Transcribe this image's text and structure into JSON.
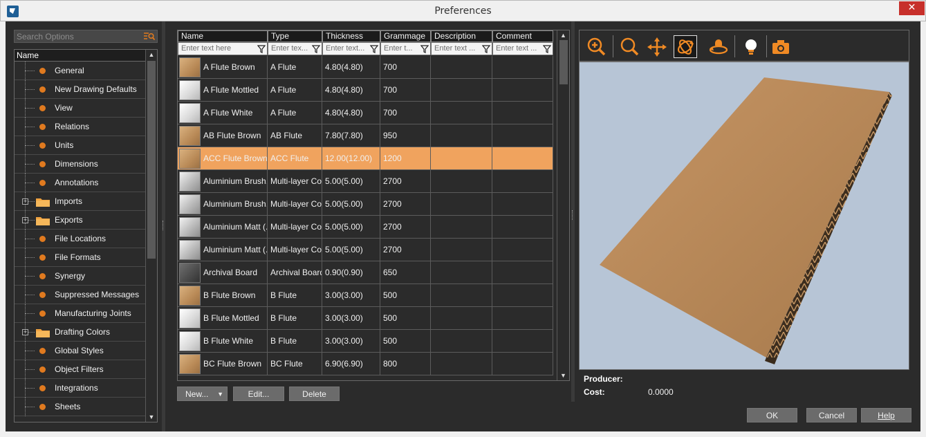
{
  "window": {
    "title": "Preferences",
    "close_glyph": "✕"
  },
  "search": {
    "placeholder": "Search Options"
  },
  "tree": {
    "header": "Name",
    "items": [
      {
        "label": "General",
        "kind": "leaf"
      },
      {
        "label": "New Drawing Defaults",
        "kind": "leaf"
      },
      {
        "label": "View",
        "kind": "leaf"
      },
      {
        "label": "Relations",
        "kind": "leaf"
      },
      {
        "label": "Units",
        "kind": "leaf"
      },
      {
        "label": "Dimensions",
        "kind": "leaf"
      },
      {
        "label": "Annotations",
        "kind": "leaf"
      },
      {
        "label": "Imports",
        "kind": "folder"
      },
      {
        "label": "Exports",
        "kind": "folder"
      },
      {
        "label": "File Locations",
        "kind": "leaf"
      },
      {
        "label": "File Formats",
        "kind": "leaf"
      },
      {
        "label": "Synergy",
        "kind": "leaf"
      },
      {
        "label": "Suppressed Messages",
        "kind": "leaf"
      },
      {
        "label": "Manufacturing Joints",
        "kind": "leaf"
      },
      {
        "label": "Drafting Colors",
        "kind": "folder"
      },
      {
        "label": "Global Styles",
        "kind": "leaf"
      },
      {
        "label": "Object Filters",
        "kind": "leaf"
      },
      {
        "label": "Integrations",
        "kind": "leaf"
      },
      {
        "label": "Sheets",
        "kind": "leaf"
      }
    ]
  },
  "grid": {
    "columns": [
      {
        "label": "Name",
        "filter": "Enter text here"
      },
      {
        "label": "Type",
        "filter": "Enter tex..."
      },
      {
        "label": "Thickness",
        "filter": "Enter text..."
      },
      {
        "label": "Grammage",
        "filter": "Enter t..."
      },
      {
        "label": "Description",
        "filter": "Enter text ..."
      },
      {
        "label": "Comment",
        "filter": "Enter text ..."
      }
    ],
    "rows": [
      {
        "name": "A Flute Brown",
        "type": "A Flute",
        "thickness": "4.80(4.80)",
        "grammage": "700",
        "swatch": "brown"
      },
      {
        "name": "A Flute Mottled",
        "type": "A Flute",
        "thickness": "4.80(4.80)",
        "grammage": "700",
        "swatch": "white"
      },
      {
        "name": "A Flute White",
        "type": "A Flute",
        "thickness": "4.80(4.80)",
        "grammage": "700",
        "swatch": "white"
      },
      {
        "name": "AB Flute Brown",
        "type": "AB Flute",
        "thickness": "7.80(7.80)",
        "grammage": "950",
        "swatch": "brown"
      },
      {
        "name": "ACC Flute Brown",
        "type": "ACC Flute",
        "thickness": "12.00(12.00)",
        "grammage": "1200",
        "swatch": "brown",
        "selected": true
      },
      {
        "name": "Aluminium Brush...",
        "type": "Multi-layer Co...",
        "thickness": "5.00(5.00)",
        "grammage": "2700",
        "swatch": "metal"
      },
      {
        "name": "Aluminium Brush...",
        "type": "Multi-layer Co...",
        "thickness": "5.00(5.00)",
        "grammage": "2700",
        "swatch": "metal"
      },
      {
        "name": "Aluminium Matt (...",
        "type": "Multi-layer Co...",
        "thickness": "5.00(5.00)",
        "grammage": "2700",
        "swatch": "metal"
      },
      {
        "name": "Aluminium Matt (...",
        "type": "Multi-layer Co...",
        "thickness": "5.00(5.00)",
        "grammage": "2700",
        "swatch": "metal"
      },
      {
        "name": "Archival Board",
        "type": "Archival Board",
        "thickness": "0.90(0.90)",
        "grammage": "650",
        "swatch": "dark"
      },
      {
        "name": "B Flute Brown",
        "type": "B Flute",
        "thickness": "3.00(3.00)",
        "grammage": "500",
        "swatch": "brown"
      },
      {
        "name": "B Flute Mottled",
        "type": "B Flute",
        "thickness": "3.00(3.00)",
        "grammage": "500",
        "swatch": "white"
      },
      {
        "name": "B Flute White",
        "type": "B Flute",
        "thickness": "3.00(3.00)",
        "grammage": "500",
        "swatch": "white"
      },
      {
        "name": "BC Flute Brown",
        "type": "BC Flute",
        "thickness": "6.90(6.90)",
        "grammage": "800",
        "swatch": "brown"
      }
    ]
  },
  "buttons": {
    "new": "New...",
    "edit": "Edit...",
    "delete": "Delete",
    "ok": "OK",
    "cancel": "Cancel",
    "help": "Help"
  },
  "viewer": {
    "tools": [
      "zoom-in-icon",
      "zoom-icon",
      "pan-icon",
      "rotate-icon",
      "orbit-icon",
      "light-icon",
      "camera-icon"
    ],
    "active_tool": "rotate-icon"
  },
  "properties": {
    "producer_label": "Producer:",
    "producer_value": "",
    "cost_label": "Cost:",
    "cost_value": "0.0000"
  },
  "colors": {
    "accent": "#e07a1f",
    "selection": "#f0a35e",
    "panel": "#2b2b2b",
    "close": "#c7302b"
  }
}
